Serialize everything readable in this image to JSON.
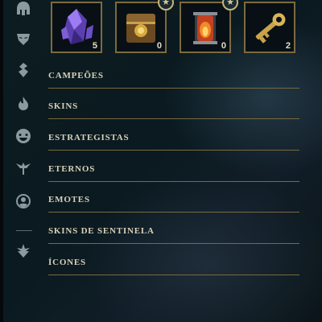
{
  "sidebar": {
    "icons": [
      "helmet-icon",
      "mask-icon",
      "ward-icon",
      "flame-icon",
      "smile-icon",
      "tree-icon",
      "profile-icon",
      "arrow-down-icon"
    ]
  },
  "inventory": {
    "slots": [
      {
        "name": "crystal-slot",
        "count": "5",
        "starred": false
      },
      {
        "name": "chest-slot",
        "count": "0",
        "starred": true
      },
      {
        "name": "capsule-slot",
        "count": "0",
        "starred": true
      },
      {
        "name": "key-slot",
        "count": "2",
        "starred": false
      }
    ]
  },
  "categories": [
    {
      "label": "CAMPEÕES"
    },
    {
      "label": "SKINS"
    },
    {
      "label": "ESTRATEGISTAS"
    },
    {
      "label": "ETERNOS"
    },
    {
      "label": "EMOTES"
    },
    {
      "label": "SKINS DE SENTINELA"
    },
    {
      "label": "ÍCONES"
    }
  ],
  "colors": {
    "accent_gold": "#7a6940",
    "label_text": "#d8cfb8",
    "background": "#0a1a20"
  }
}
